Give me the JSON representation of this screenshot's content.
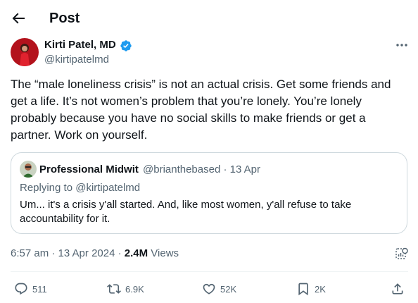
{
  "header": {
    "title": "Post"
  },
  "author": {
    "name": "Kirti Patel, MD",
    "handle": "@kirtipatelmd"
  },
  "post": {
    "text": "The “male loneliness crisis” is not an actual crisis. Get some friends and get a life. It’s not women’s problem that you’re lonely. You’re lonely probably because you have no social skills to make friends or get a partner. Work on yourself."
  },
  "quote": {
    "name": "Professional Midwit",
    "handle_date": "@brianthebased · 13 Apr",
    "replying": "Replying to @kirtipatelmd",
    "text": "Um... it's a crisis y'all started. And, like most women, y'all refuse to take accountability for it."
  },
  "meta": {
    "time_date": "6:57 am · 13 Apr 2024 · ",
    "views_count": "2.4M",
    "views_label": " Views"
  },
  "actions": {
    "replies": "511",
    "reposts": "6.9K",
    "likes": "52K",
    "bookmarks": "2K"
  },
  "colors": {
    "text": "#0f1419",
    "secondary": "#536471",
    "verified": "#1d9bf0",
    "border": "#cfd9de"
  },
  "icons": [
    "back-arrow-icon",
    "verified-badge-icon",
    "more-icon",
    "analytics-icon",
    "reply-icon",
    "repost-icon",
    "like-icon",
    "bookmark-icon",
    "share-icon"
  ]
}
